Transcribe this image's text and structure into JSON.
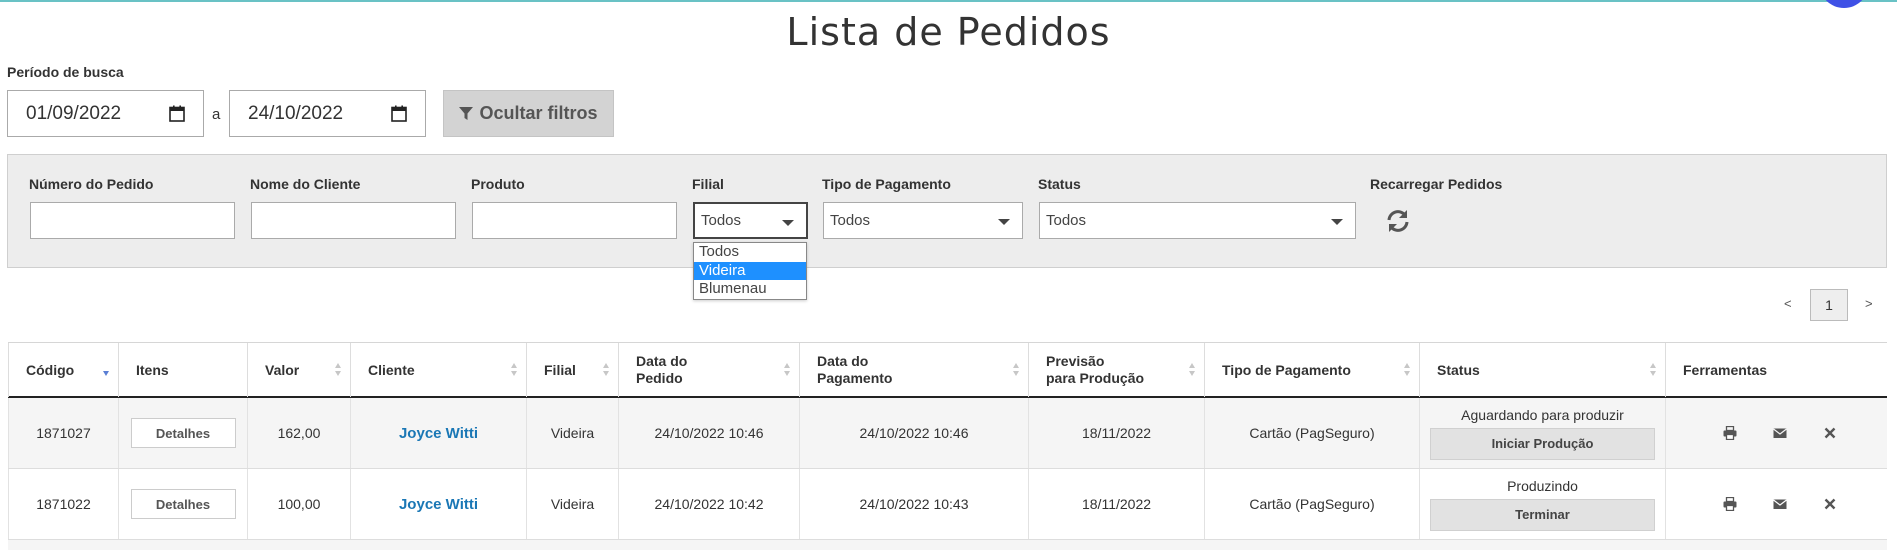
{
  "page": {
    "title": "Lista de Pedidos"
  },
  "periodo": {
    "label": "Período de busca",
    "start": "01/09/2022",
    "separator": "a",
    "end": "24/10/2022",
    "hide_filters_label": "Ocultar filtros"
  },
  "filters": {
    "numero_label": "Número do Pedido",
    "cliente_label": "Nome do Cliente",
    "produto_label": "Produto",
    "filial_label": "Filial",
    "filial_value": "Todos",
    "filial_options": [
      "Todos",
      "Videira",
      "Blumenau"
    ],
    "filial_highlighted": "Videira",
    "pagamento_label": "Tipo de Pagamento",
    "pagamento_value": "Todos",
    "status_label": "Status",
    "status_value": "Todos",
    "reload_label": "Recarregar Pedidos"
  },
  "pagination": {
    "prev": "<",
    "current": "1",
    "next": ">"
  },
  "table": {
    "headers": [
      "Código",
      "Itens",
      "Valor",
      "Cliente",
      "Filial",
      "Data do\nPedido",
      "Data do\nPagamento",
      "Previsão\npara Produção",
      "Tipo de Pagamento",
      "Status",
      "Ferramentas"
    ],
    "rows": [
      {
        "codigo": "1871027",
        "itens": "Detalhes",
        "valor": "162,00",
        "cliente": "Joyce Witti",
        "filial": "Videira",
        "data_pedido": "24/10/2022 10:46",
        "data_pagamento": "24/10/2022 10:46",
        "previsao": "18/11/2022",
        "tipo_pagamento": "Cartão (PagSeguro)",
        "status": "Aguardando para produzir",
        "status_action": "Iniciar Produção"
      },
      {
        "codigo": "1871022",
        "itens": "Detalhes",
        "valor": "100,00",
        "cliente": "Joyce Witti",
        "filial": "Videira",
        "data_pedido": "24/10/2022 10:42",
        "data_pagamento": "24/10/2022 10:43",
        "previsao": "18/11/2022",
        "tipo_pagamento": "Cartão (PagSeguro)",
        "status": "Produzindo",
        "status_action": "Terminar"
      }
    ]
  },
  "icons": {
    "filter": "filter-icon",
    "calendar": "calendar-icon",
    "reload": "refresh-icon",
    "print": "print-icon",
    "email": "envelope-icon",
    "delete": "close-icon"
  },
  "colors": {
    "link": "#1a77b5",
    "highlight": "#1e90ff",
    "accent_line": "#69c2c5"
  }
}
